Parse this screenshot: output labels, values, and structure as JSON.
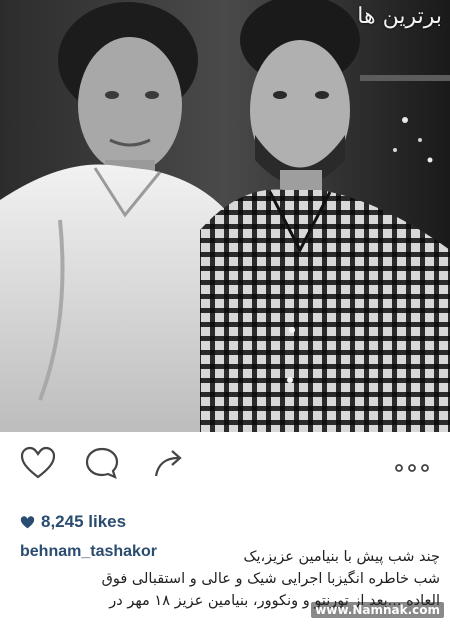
{
  "photo": {
    "description_icon": "photo-of-two-men",
    "watermark_top": "برترین ها"
  },
  "actions": {
    "like_icon": "heart-outline-icon",
    "comment_icon": "comment-bubble-icon",
    "share_icon": "share-arrow-icon",
    "more_icon": "more-dots-icon"
  },
  "likes": {
    "count": "8,245 likes"
  },
  "post": {
    "username": "behnam_tashakor",
    "caption_lines": [
      "چند شب پیش با بنیامین عزیز،یک",
      "شب خاطره انگیزبا اجرایی شیک و عالی و استقبالی فوق",
      "العاده ...بعد از تورنتو و ونکوور، بنیامین عزیز ۱۸ مهر در"
    ]
  },
  "watermark_bottom": "www.Namnak.com",
  "colors": {
    "link": "#2a4c70",
    "icon": "#444444"
  }
}
